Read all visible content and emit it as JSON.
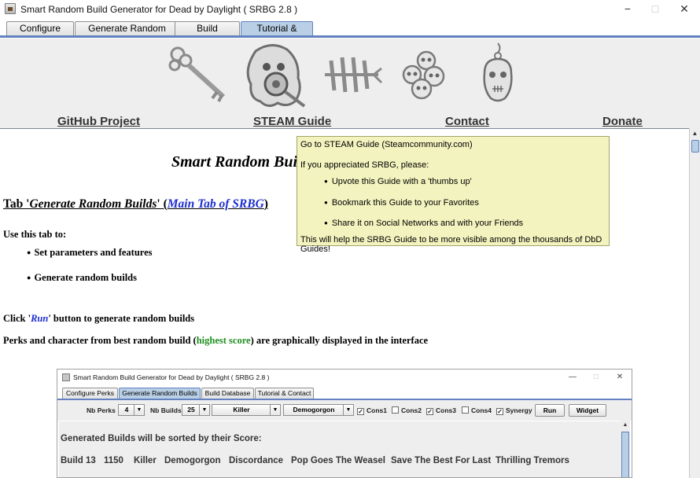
{
  "window": {
    "title": "Smart Random Build Generator for Dead by Daylight ( SRBG 2.8 )",
    "minimize": "−",
    "maximize": "□",
    "close": "✕"
  },
  "tabs": [
    {
      "label": "Configure Perks"
    },
    {
      "label": "Generate Random Builds"
    },
    {
      "label": "Build Database"
    },
    {
      "label": "Tutorial & Contact",
      "active": true
    }
  ],
  "header": {
    "logos": [
      "key-icon",
      "ghost-icon",
      "hook-icon",
      "skulls-icon",
      "skull-charm-icon"
    ],
    "links": {
      "github": "GitHub Project",
      "steam": "STEAM Guide",
      "contact": "Contact",
      "donate": "Donate"
    }
  },
  "doc": {
    "title": "Smart Random Bui",
    "section_prefix": "Tab '",
    "section_tab_name": "Generate Random Builds",
    "section_mid": "' (",
    "section_link": "Main Tab of SRBG",
    "section_suffix": ")",
    "use_this_tab": "Use this tab to:",
    "bullets": [
      "Set parameters and features",
      "Generate random builds"
    ],
    "click_prefix": "Click '",
    "click_run": "Run",
    "click_suffix": "' button to generate random builds",
    "perks_prefix": "Perks and character from best random build (",
    "perks_highlight": "highest score",
    "perks_suffix": ") are graphically displayed in the interface"
  },
  "tooltip": {
    "line1": "Go to STEAM Guide (Steamcommunity.com)",
    "line2": "If you appreciated SRBG, please:",
    "bullets": [
      "Upvote this Guide with a 'thumbs up'",
      "Bookmark this Guide to your Favorites",
      "Share it on Social Networks and with your Friends"
    ],
    "footer": "This will help the SRBG Guide to be more visible among the thousands of DbD Guides!"
  },
  "embedded": {
    "title": "Smart Random Build Generator for Dead by Daylight ( SRBG 2.8 )",
    "minimize": "—",
    "maximize": "□",
    "close": "✕",
    "tabs": [
      {
        "label": "Configure Perks"
      },
      {
        "label": "Generate Random Builds",
        "active": true
      },
      {
        "label": "Build Database"
      },
      {
        "label": "Tutorial & Contact"
      }
    ],
    "controls": {
      "nb_perks_label": "Nb Perks",
      "nb_perks_value": "4",
      "nb_builds_label": "Nb Builds",
      "nb_builds_value": "25",
      "role_value": "Killer",
      "character_value": "Demogorgon",
      "checkboxes": [
        {
          "label": "Cons1",
          "checked": true
        },
        {
          "label": "Cons2",
          "checked": false
        },
        {
          "label": "Cons3",
          "checked": true
        },
        {
          "label": "Cons4",
          "checked": false
        },
        {
          "label": "Synergy",
          "checked": true
        }
      ],
      "run_label": "Run",
      "widget_label": "Widget"
    },
    "sorted_text": "Generated Builds will be sorted by their Score:",
    "build_row": [
      "Build 13",
      "1150",
      "Killer",
      "Demogorgon",
      "Discordance",
      "Pop Goes The Weasel",
      "Save The Best For Last",
      "Thrilling Tremors"
    ]
  },
  "colors": {
    "active_tab": "#b8cfe5",
    "tab_accent": "#6382bf",
    "link_blue": "#1c2ed0",
    "highlight_green": "#1f8f1f",
    "tooltip_bg": "#f3f3bf"
  }
}
